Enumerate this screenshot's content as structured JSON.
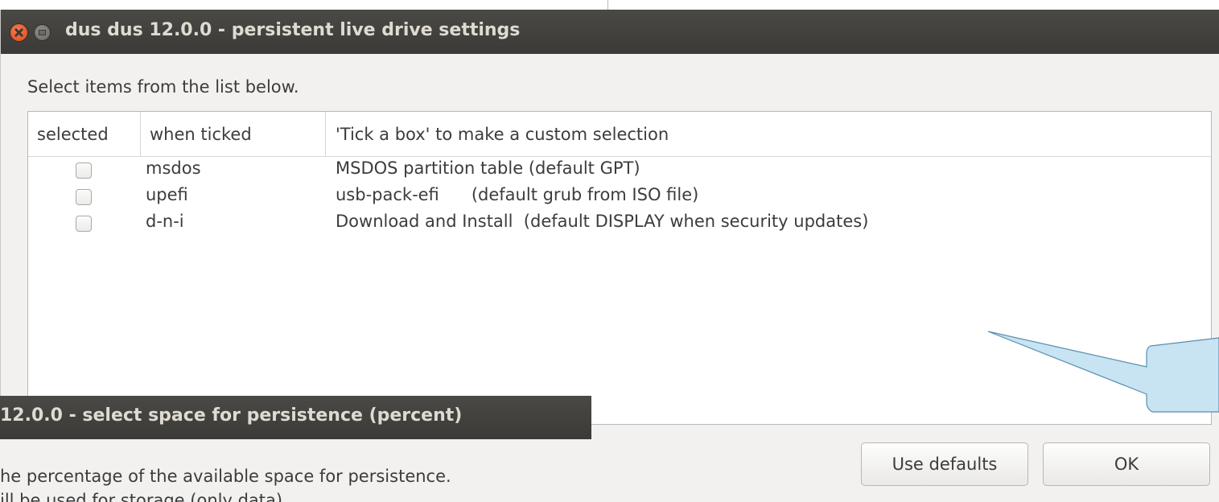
{
  "main_window": {
    "title": "dus dus 12.0.0 - persistent live drive settings",
    "instruction": "Select items from the list below.",
    "columns": {
      "selected": "selected",
      "when_ticked": "when ticked",
      "description": "'Tick a box' to make a custom selection"
    },
    "rows": [
      {
        "checked": false,
        "when": "msdos",
        "description": "MSDOS partition table (default GPT)"
      },
      {
        "checked": false,
        "when": "upefi",
        "description": "usb-pack-efi      (default grub from ISO file)"
      },
      {
        "checked": false,
        "when": "d-n-i",
        "description": "Download and Install  (default DISPLAY when security updates)"
      }
    ],
    "buttons": {
      "use_defaults": "Use defaults",
      "ok": "OK"
    }
  },
  "sub_window": {
    "title": "12.0.0 - select space for persistence (percent)",
    "text_line_1": "he percentage of the available space for persistence.",
    "text_line_2": "                    ill be used for storage (only data)"
  },
  "colors": {
    "titlebar": "#3c3b37",
    "window_bg": "#f2f1f0",
    "close_button": "#e7561e",
    "callout_fill": "#c8e3f2",
    "callout_stroke": "#5a8fb0"
  }
}
